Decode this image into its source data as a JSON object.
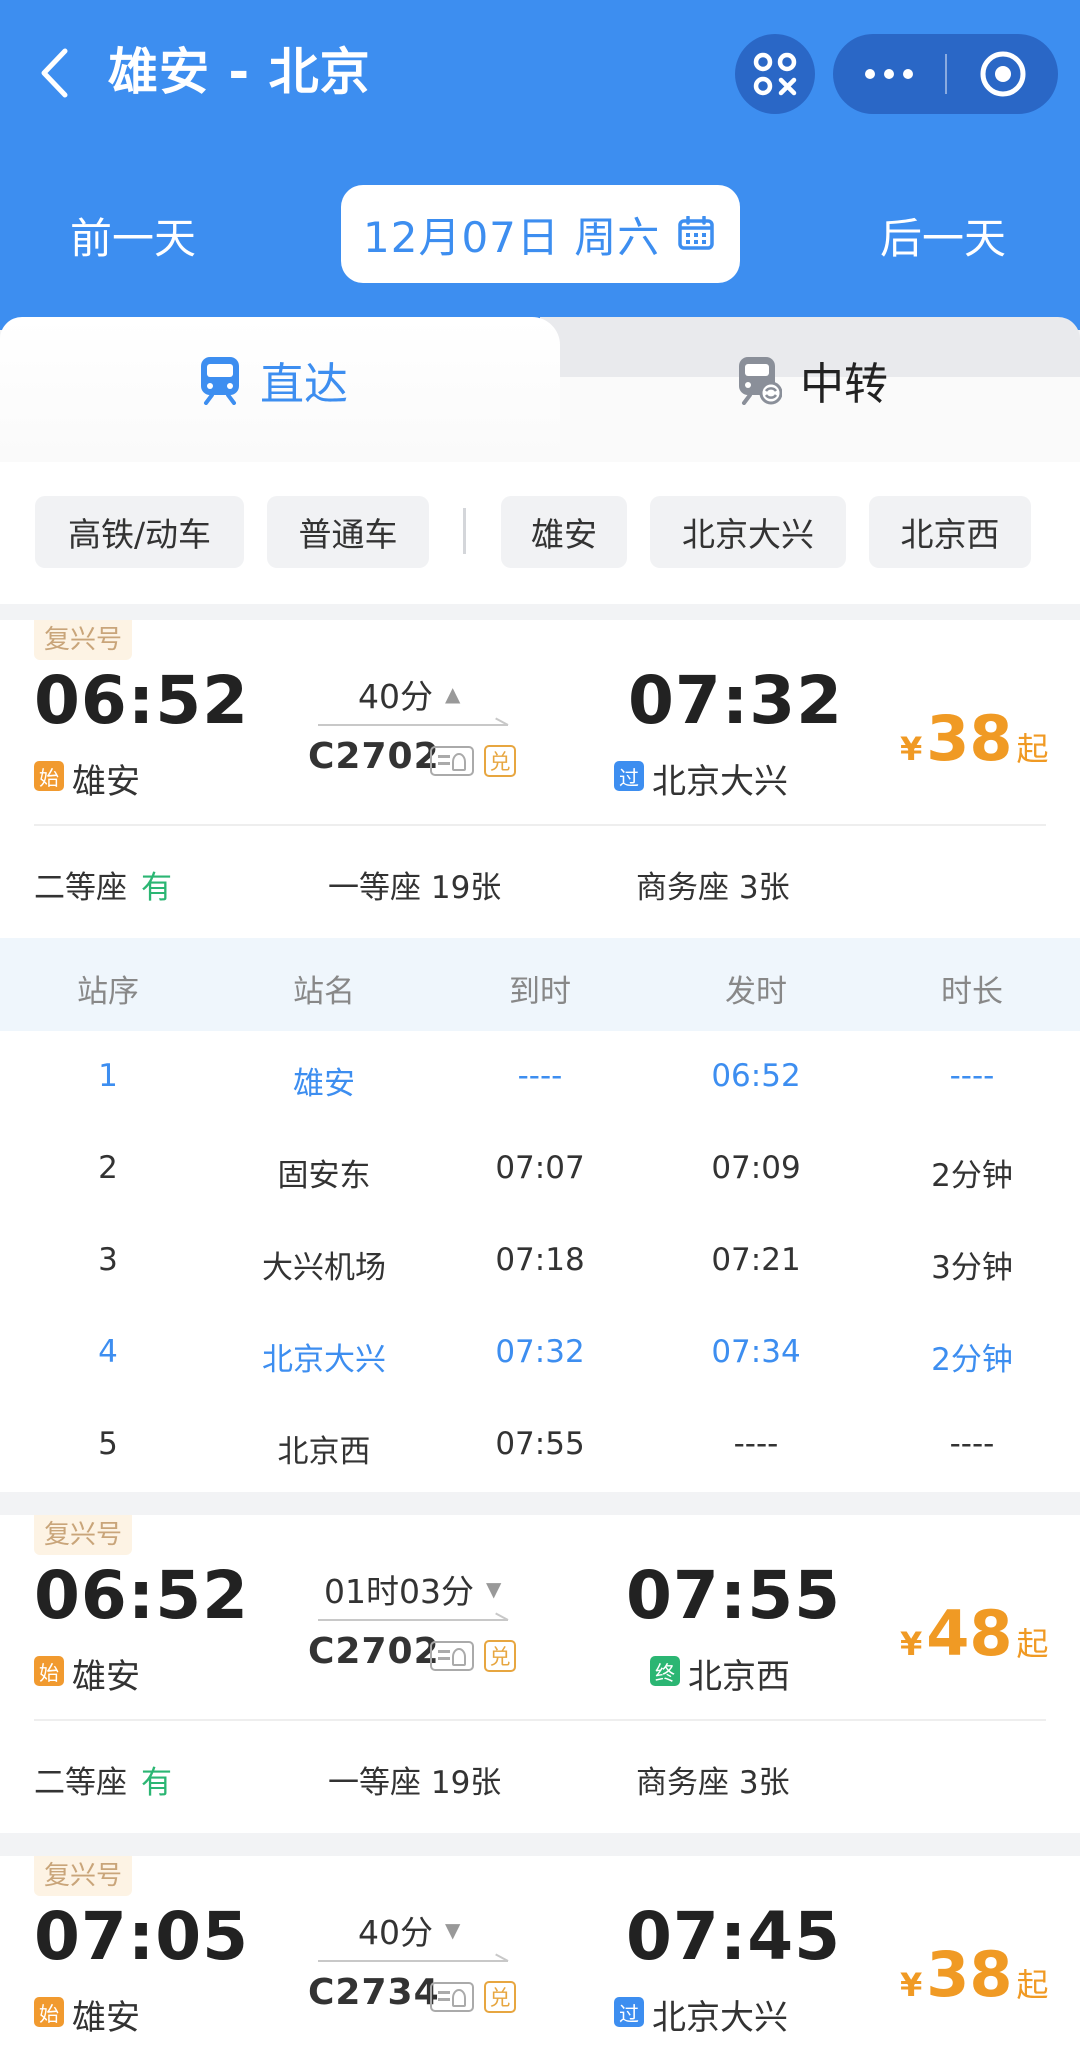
{
  "header": {
    "title": "雄安 - 北京",
    "prev_day": "前一天",
    "date": "12月07日 周六",
    "next_day": "后一天"
  },
  "tabs": [
    {
      "label": "直达",
      "active": true
    },
    {
      "label": "中转",
      "active": false
    }
  ],
  "filters": {
    "train_types": [
      "高铁/动车",
      "普通车"
    ],
    "stations": [
      "雄安",
      "北京大兴",
      "北京西"
    ]
  },
  "trains": [
    {
      "badge": "复兴号",
      "dep_time": "06:52",
      "duration": "40分",
      "train_no": "C2702",
      "arr_time": "07:32",
      "dep_tag": "始",
      "dep_station": "雄安",
      "arr_tag": "过",
      "arr_station": "北京大兴",
      "price_symbol": "¥",
      "price": "38",
      "price_suffix": "起",
      "seats": [
        {
          "name": "二等座",
          "value": "有"
        },
        {
          "name": "一等座",
          "value": "19张"
        },
        {
          "name": "商务座",
          "value": "3张"
        }
      ],
      "expanded": true
    },
    {
      "badge": "复兴号",
      "dep_time": "06:52",
      "duration": "01时03分",
      "train_no": "C2702",
      "arr_time": "07:55",
      "dep_tag": "始",
      "dep_station": "雄安",
      "arr_tag": "终",
      "arr_station": "北京西",
      "price_symbol": "¥",
      "price": "48",
      "price_suffix": "起",
      "seats": [
        {
          "name": "二等座",
          "value": "有"
        },
        {
          "name": "一等座",
          "value": "19张"
        },
        {
          "name": "商务座",
          "value": "3张"
        }
      ],
      "expanded": false
    },
    {
      "badge": "复兴号",
      "dep_time": "07:05",
      "duration": "40分",
      "train_no": "C2734",
      "arr_time": "07:45",
      "dep_tag": "始",
      "dep_station": "雄安",
      "arr_tag": "过",
      "arr_station": "北京大兴",
      "price_symbol": "¥",
      "price": "38",
      "price_suffix": "起",
      "expanded": false
    }
  ],
  "stops_table": {
    "headers": [
      "站序",
      "站名",
      "到时",
      "发时",
      "时长"
    ],
    "rows": [
      [
        "1",
        "雄安",
        "----",
        "06:52",
        "----"
      ],
      [
        "2",
        "固安东",
        "07:07",
        "07:09",
        "2分钟"
      ],
      [
        "3",
        "大兴机场",
        "07:18",
        "07:21",
        "3分钟"
      ],
      [
        "4",
        "北京大兴",
        "07:32",
        "07:34",
        "2分钟"
      ],
      [
        "5",
        "北京西",
        "07:55",
        "----",
        "----"
      ]
    ]
  },
  "icons": {
    "dui": "兑"
  },
  "colors": {
    "primary": "#3d8ef0",
    "price": "#f09a24",
    "available": "#2bb673",
    "badge_text": "#c9a57a"
  }
}
